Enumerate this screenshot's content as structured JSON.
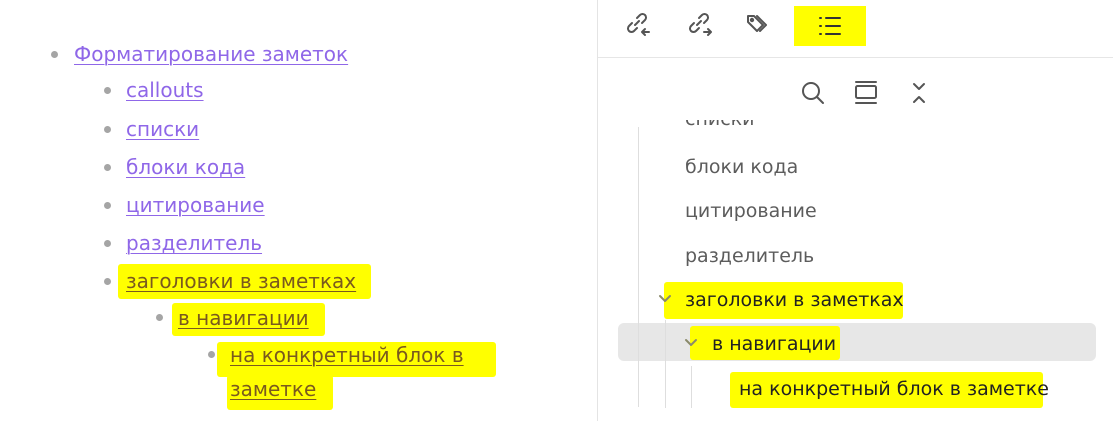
{
  "document": {
    "items": [
      {
        "label": "Форматирование заметок",
        "level": 0
      },
      {
        "label": "callouts",
        "level": 1
      },
      {
        "label": "списки",
        "level": 1
      },
      {
        "label": "блоки кода",
        "level": 1
      },
      {
        "label": "цитирование",
        "level": 1
      },
      {
        "label": "разделитель",
        "level": 1
      },
      {
        "label": "заголовки в заметках",
        "level": 1,
        "highlighted": true
      },
      {
        "label": "в навигации",
        "level": 2,
        "highlighted": true
      },
      {
        "label_line1": "на конкретный блок в",
        "label_line2": "заметке",
        "level": 3,
        "highlighted": true
      }
    ]
  },
  "outline_panel": {
    "tabs": [
      {
        "name": "backlinks",
        "icon": "link-incoming-icon"
      },
      {
        "name": "outgoing-links",
        "icon": "link-outgoing-icon"
      },
      {
        "name": "tags",
        "icon": "tags-icon"
      },
      {
        "name": "outline",
        "icon": "list-icon",
        "active": true
      }
    ],
    "toolbar": [
      "search-icon",
      "collapse-all-icon",
      "expand-collapse-icon"
    ],
    "items": [
      {
        "label": "списки",
        "depth": 0,
        "partially_hidden": true
      },
      {
        "label": "блоки кода",
        "depth": 0
      },
      {
        "label": "цитирование",
        "depth": 0
      },
      {
        "label": "разделитель",
        "depth": 0
      },
      {
        "label": "заголовки в заметках",
        "depth": 0,
        "expanded": true,
        "highlighted": true
      },
      {
        "label": "в навигации",
        "depth": 1,
        "expanded": true,
        "highlighted": true,
        "selected": true
      },
      {
        "label": "на конкретный блок в заметке",
        "depth": 2,
        "highlighted": true
      }
    ]
  },
  "colors": {
    "link": "#8f67e8",
    "highlight": "#ffff00",
    "outline_text": "#5c5c5c",
    "selected_row": "#e7e7e7"
  }
}
